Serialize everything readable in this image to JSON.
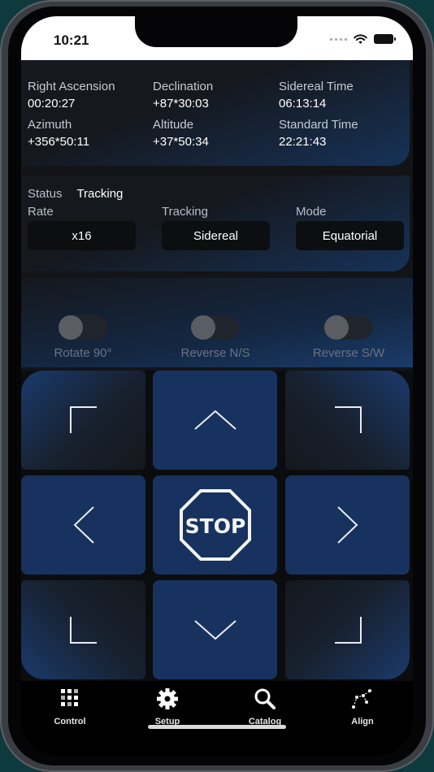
{
  "status_bar": {
    "time": "10:21"
  },
  "coordinates": [
    {
      "label": "Right Ascension",
      "value": "00:20:27"
    },
    {
      "label": "Declination",
      "value": "+87*30:03"
    },
    {
      "label": "Sidereal Time",
      "value": "06:13:14"
    },
    {
      "label": "Azimuth",
      "value": "+356*50:11"
    },
    {
      "label": "Altitude",
      "value": "+37*50:34"
    },
    {
      "label": "Standard Time",
      "value": "22:21:43"
    }
  ],
  "status": {
    "label": "Status",
    "value": "Tracking"
  },
  "controls": {
    "rate": {
      "label": "Rate",
      "value": "x16"
    },
    "tracking": {
      "label": "Tracking",
      "value": "Sidereal"
    },
    "mode": {
      "label": "Mode",
      "value": "Equatorial"
    }
  },
  "toggles": [
    {
      "label": "Rotate 90°",
      "on": false
    },
    {
      "label": "Reverse N/S",
      "on": false
    },
    {
      "label": "Reverse S/W",
      "on": false
    }
  ],
  "stop_label": "STOP",
  "tabs": [
    {
      "label": "Control",
      "icon": "control-grid-icon"
    },
    {
      "label": "Setup",
      "icon": "gear-icon"
    },
    {
      "label": "Catalog",
      "icon": "magnifier-icon"
    },
    {
      "label": "Align",
      "icon": "constellation-icon"
    }
  ],
  "colors": {
    "accent_blue": "#17325e",
    "panel_dark": "#15181d",
    "background": "#121418"
  }
}
